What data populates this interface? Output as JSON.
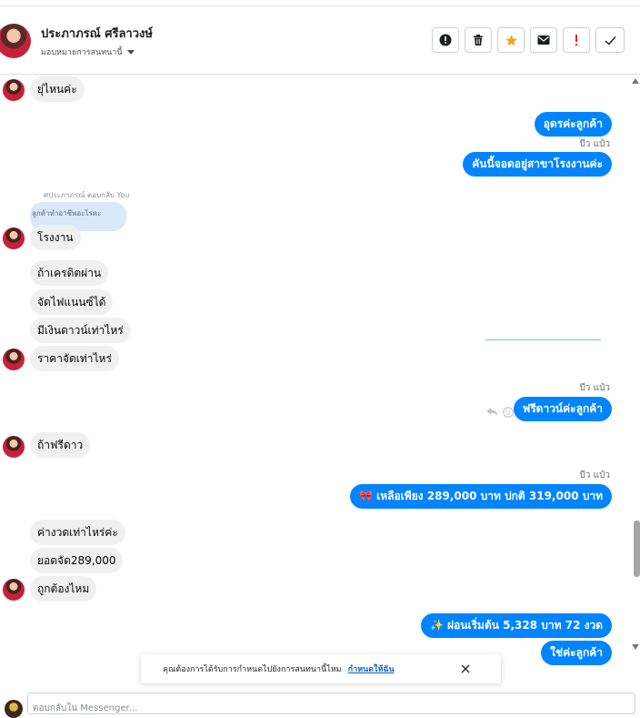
{
  "header": {
    "name": "ประภาภรณ์ ศรีลาวงษ์",
    "assign_label": "มอบหมายการสนทนานี้",
    "tools": [
      {
        "icon": "alert-icon",
        "action": "mark-spam"
      },
      {
        "icon": "trash-icon",
        "action": "delete"
      },
      {
        "icon": "star-icon",
        "action": "star",
        "color": "#f7a221"
      },
      {
        "icon": "mail-icon",
        "action": "mark-unread"
      },
      {
        "icon": "exclamation-icon",
        "action": "important",
        "color": "#e02424"
      },
      {
        "icon": "check-icon",
        "action": "done"
      }
    ]
  },
  "messages": {
    "m1": "ยุ่ไหนค่ะ",
    "m2": "อุดรค่ะลูกค้า",
    "sender1": "บีว แป๋ว",
    "m3": "คันนี้จอดอยู่สาขาโรงงานค่ะ",
    "reply_meta": "ศประภาภรณ์ ตอบกลับ You",
    "reply_quote": "ลูกค้าทำอาชีพอะไรคะ",
    "m4": "โรงงาน",
    "m5": "ถ้าเครดิตผ่าน",
    "m6": "จัดไฟแนนซ์ได้",
    "m7": "มีเงินดาวน์เท่าไหร่",
    "m8": "ราคาจัดเท่าไหร่",
    "sender2": "บีว แป๋ว",
    "m9": "ฟรีดาวน์ค่ะลูกค้า",
    "m10": "ถ้าฟรีดาว",
    "sender3": "บีว แป๋ว",
    "m11": "🎀 เหลือเพียง 289,000 บาท ปกติ 319,000 บาท",
    "m12": "ค่างวดเท่าไหร่ค่ะ",
    "m13": "ยอดจัด289,000",
    "m14": "ถูกต้องไหม",
    "m15": "✨ ผ่อนเริ่มต้น 5,328  บาท 72 งวด",
    "m16": "ใช่ค่ะลูกค้า"
  },
  "toast": {
    "text": "คุณต้องการได้รับการกำหนดไปยังการสนทนานี้ไหม",
    "link": "กำหนดให้ฉัน"
  },
  "composer": {
    "placeholder": "ตอบกลับใน Messenger..."
  },
  "colors": {
    "outgoing": "#0084ff",
    "incoming": "#f0f0f0",
    "link": "#1565c0"
  }
}
